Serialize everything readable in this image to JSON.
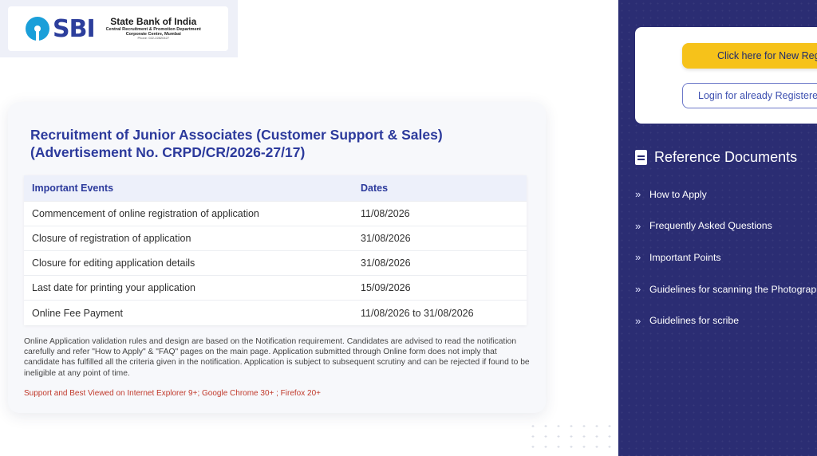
{
  "header": {
    "logo_text": "SBI",
    "bank_name": "State Bank of India",
    "department": "Central Recruitment & Promotion Department",
    "centre": "Corporate Centre, Mumbai",
    "phone": "Phone: 022-22820427"
  },
  "main": {
    "title": "Recruitment of Junior Associates (Customer Support & Sales) (Advertisement No. CRPD/CR/2026-27/17)",
    "table": {
      "headers": [
        "Important Events",
        "Dates"
      ],
      "rows": [
        [
          "Commencement of online registration of application",
          "11/08/2026"
        ],
        [
          "Closure of registration of application",
          "31/08/2026"
        ],
        [
          "Closure for editing application details",
          "31/08/2026"
        ],
        [
          "Last date for printing your application",
          "15/09/2026"
        ],
        [
          "Online Fee Payment",
          "11/08/2026 to 31/08/2026"
        ]
      ]
    },
    "note": "Online Application validation rules and design are based on the Notification requirement. Candidates are advised to read the notification carefully and refer \"How to Apply\" & \"FAQ\" pages on the main page. Application submitted through Online form does not imply that candidate has fulfilled all the criteria given in the notification. Application is subject to subsequent scrutiny and can be rejected if found to be ineligible at any point of time.",
    "support": "Support and Best Viewed on Internet Explorer 9+; Google Chrome 30+ ; Firefox 20+"
  },
  "sidebar": {
    "new_registration_label": "Click here for New Registration",
    "login_label": "Login for already Registered",
    "reference_title": "Reference Documents",
    "items": [
      {
        "label": "How to Apply",
        "icon": "double-chevron-right-icon"
      },
      {
        "label": "Frequently Asked Questions",
        "icon": "double-chevron-right-icon"
      },
      {
        "label": "Important Points",
        "icon": "double-chevron-right-icon"
      },
      {
        "label": "Guidelines for scanning the Photograph",
        "icon": "double-chevron-right-icon"
      },
      {
        "label": "Guidelines for scribe",
        "icon": "double-chevron-right-icon"
      }
    ]
  },
  "colors": {
    "brand_blue": "#2c3a9c",
    "panel_bg": "#2b2d73",
    "cta_yellow": "#f6c21a",
    "warning_red": "#c0392b"
  }
}
